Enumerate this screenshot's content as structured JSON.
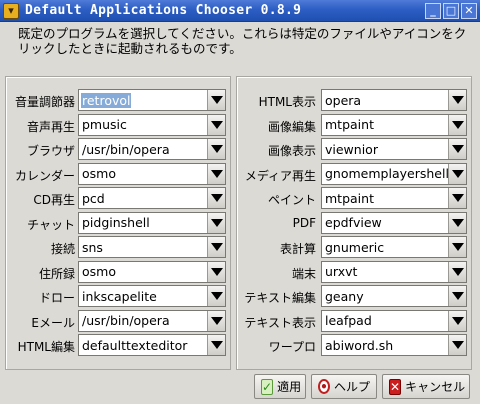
{
  "window": {
    "title": "Default Applications Chooser 0.8.9"
  },
  "intro": "既定のプログラムを選択してください。これらは特定のファイルやアイコンをクリックしたときに起動されるものです。",
  "left": [
    {
      "label": "音量調節器",
      "value": "retrovol"
    },
    {
      "label": "音声再生",
      "value": "pmusic"
    },
    {
      "label": "ブラウザ",
      "value": "/usr/bin/opera"
    },
    {
      "label": "カレンダー",
      "value": "osmo"
    },
    {
      "label": "CD再生",
      "value": "pcd"
    },
    {
      "label": "チャット",
      "value": "pidginshell"
    },
    {
      "label": "接続",
      "value": "sns"
    },
    {
      "label": "住所録",
      "value": "osmo"
    },
    {
      "label": "ドロー",
      "value": "inkscapelite"
    },
    {
      "label": "Eメール",
      "value": "/usr/bin/opera"
    },
    {
      "label": "HTML編集",
      "value": "defaulttexteditor"
    }
  ],
  "right": [
    {
      "label": "HTML表示",
      "value": "opera"
    },
    {
      "label": "画像編集",
      "value": "mtpaint"
    },
    {
      "label": "画像表示",
      "value": "viewnior"
    },
    {
      "label": "メディア再生",
      "value": "gnomemplayershell"
    },
    {
      "label": "ペイント",
      "value": "mtpaint"
    },
    {
      "label": "PDF",
      "value": "epdfview"
    },
    {
      "label": "表計算",
      "value": "gnumeric"
    },
    {
      "label": "端末",
      "value": "urxvt"
    },
    {
      "label": "テキスト編集",
      "value": "geany"
    },
    {
      "label": "テキスト表示",
      "value": "leafpad"
    },
    {
      "label": "ワープロ",
      "value": "abiword.sh"
    }
  ],
  "buttons": {
    "apply": "適用",
    "help": "ヘルプ",
    "cancel": "キャンセル"
  },
  "icons": {
    "apply": "check-icon",
    "help": "help-lifebuoy-icon",
    "cancel": "cancel-x-icon"
  }
}
